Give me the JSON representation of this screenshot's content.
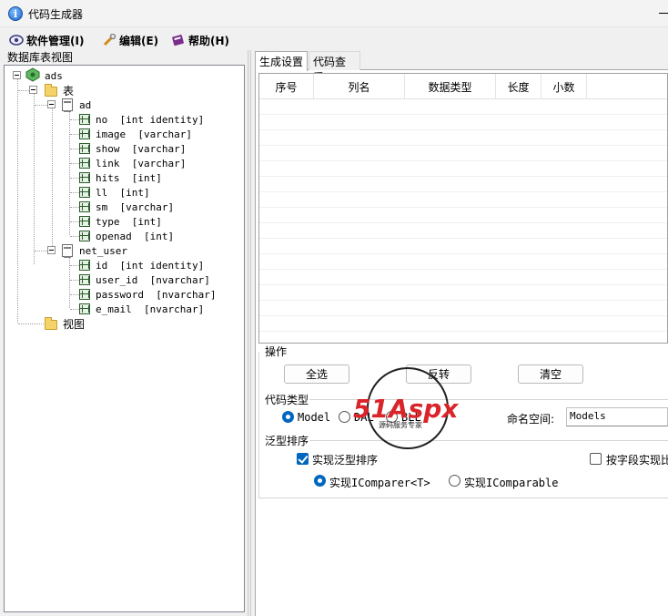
{
  "window": {
    "title": "代码生成器"
  },
  "menu": [
    {
      "label": "软件管理(I)",
      "icon": "gear-icon"
    },
    {
      "label": "编辑(E)",
      "icon": "wrench-icon"
    },
    {
      "label": "帮助(H)",
      "icon": "book-icon"
    }
  ],
  "tree": {
    "panel_title": "数据库表视图",
    "root": "ads",
    "tables_folder": "表",
    "views_folder": "视图",
    "tables": [
      {
        "name": "ad",
        "columns": [
          "no  [int identity]",
          "image  [varchar]",
          "show  [varchar]",
          "link  [varchar]",
          "hits  [int]",
          "ll  [int]",
          "sm  [varchar]",
          "type  [int]",
          "openad  [int]"
        ]
      },
      {
        "name": "net_user",
        "columns": [
          "id  [int identity]",
          "user_id  [nvarchar]",
          "password  [nvarchar]",
          "e_mail  [nvarchar]"
        ]
      }
    ]
  },
  "tabs": [
    {
      "label": "生成设置",
      "active": true
    },
    {
      "label": "代码查看",
      "active": false
    }
  ],
  "grid": {
    "columns": [
      "序号",
      "列名",
      "数据类型",
      "长度",
      "小数"
    ]
  },
  "operations": {
    "title": "操作",
    "select_all": "全选",
    "invert": "反转",
    "clear": "清空"
  },
  "code_type": {
    "title": "代码类型",
    "options": [
      "Model",
      "DAL",
      "BLL"
    ],
    "selected": "Model",
    "namespace_label": "命名空间:",
    "namespace_value": "Models"
  },
  "generic_sort": {
    "title": "泛型排序",
    "implement_label": "实现泛型排序",
    "implement_checked": true,
    "field_label": "按字段实现比",
    "field_checked": false,
    "comparer_option": "实现IComparer<T>",
    "comparable_option": "实现IComparable",
    "selected": "实现IComparer<T>"
  },
  "watermark": {
    "brand": "51Aspx",
    "subtitle": "源码服务专家"
  },
  "colors": {
    "accent": "#0067c0",
    "watermark_red": "#d9242a",
    "watermark_green": "#2c9a3a"
  }
}
